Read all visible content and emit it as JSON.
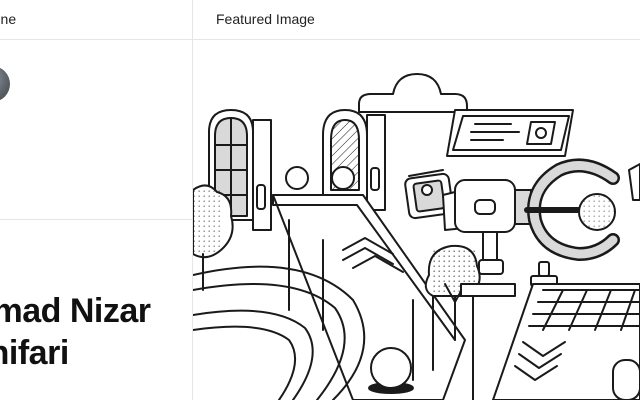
{
  "left_panel": {
    "header_label": "Byline",
    "author_name_line1": "Muhammad Nizar",
    "author_name_line2": "Ulinnuur Ghifari"
  },
  "right_panel": {
    "header_label": "Featured Image"
  },
  "colors": {
    "border": "#e6e6e6",
    "ink": "#1a1a1a",
    "fill_gray": "#d9d9d9"
  }
}
